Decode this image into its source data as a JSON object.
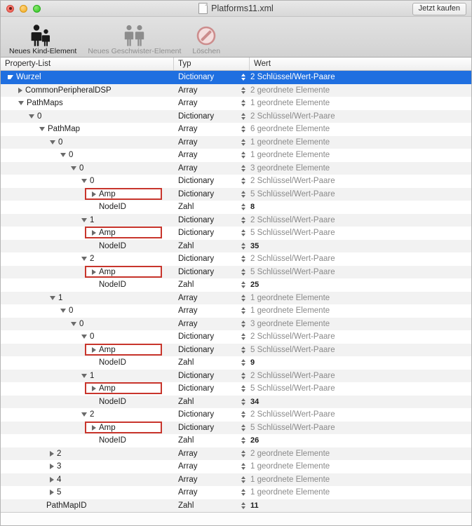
{
  "window": {
    "title": "Platforms11.xml",
    "buy_button": "Jetzt kaufen",
    "traffic_lights": [
      "close-light",
      "minimize-light",
      "zoom-light"
    ],
    "doc_icon": "document-icon"
  },
  "toolbar": {
    "items": [
      {
        "label": "Neues Kind-Element",
        "icon": "two-people-icon",
        "enabled": true
      },
      {
        "label": "Neues Geschwister-Element",
        "icon": "two-people-icon",
        "enabled": false
      },
      {
        "label": "Löschen",
        "icon": "no-entry-icon",
        "enabled": false
      }
    ]
  },
  "columns": {
    "name": "Property-List",
    "type": "Typ",
    "value": "Wert"
  },
  "rows": [
    {
      "level": 0,
      "name": "Wurzel",
      "tri": "open",
      "type": "Dictionary",
      "value": "2 Schlüssel/Wert-Paare",
      "kind": "muted",
      "selected": true,
      "boxed": false
    },
    {
      "level": 1,
      "name": "CommonPeripheralDSP",
      "tri": "closed",
      "type": "Array",
      "value": "2 geordnete Elemente",
      "kind": "muted",
      "selected": false,
      "boxed": false
    },
    {
      "level": 1,
      "name": "PathMaps",
      "tri": "open",
      "type": "Array",
      "value": "1 geordnete Elemente",
      "kind": "muted",
      "selected": false,
      "boxed": false
    },
    {
      "level": 2,
      "name": "0",
      "tri": "open",
      "type": "Dictionary",
      "value": "2 Schlüssel/Wert-Paare",
      "kind": "muted",
      "selected": false,
      "boxed": false
    },
    {
      "level": 3,
      "name": "PathMap",
      "tri": "open",
      "type": "Array",
      "value": "6 geordnete Elemente",
      "kind": "muted",
      "selected": false,
      "boxed": false
    },
    {
      "level": 4,
      "name": "0",
      "tri": "open",
      "type": "Array",
      "value": "1 geordnete Elemente",
      "kind": "muted",
      "selected": false,
      "boxed": false
    },
    {
      "level": 5,
      "name": "0",
      "tri": "open",
      "type": "Array",
      "value": "1 geordnete Elemente",
      "kind": "muted",
      "selected": false,
      "boxed": false
    },
    {
      "level": 6,
      "name": "0",
      "tri": "open",
      "type": "Array",
      "value": "3 geordnete Elemente",
      "kind": "muted",
      "selected": false,
      "boxed": false
    },
    {
      "level": 7,
      "name": "0",
      "tri": "open",
      "type": "Dictionary",
      "value": "2 Schlüssel/Wert-Paare",
      "kind": "muted",
      "selected": false,
      "boxed": false
    },
    {
      "level": 8,
      "name": "Amp",
      "tri": "closed",
      "type": "Dictionary",
      "value": "5 Schlüssel/Wert-Paare",
      "kind": "muted",
      "selected": false,
      "boxed": true
    },
    {
      "level": 8,
      "name": "NodeID",
      "tri": "none",
      "type": "Zahl",
      "value": "8",
      "kind": "num",
      "selected": false,
      "boxed": false
    },
    {
      "level": 7,
      "name": "1",
      "tri": "open",
      "type": "Dictionary",
      "value": "2 Schlüssel/Wert-Paare",
      "kind": "muted",
      "selected": false,
      "boxed": false
    },
    {
      "level": 8,
      "name": "Amp",
      "tri": "closed",
      "type": "Dictionary",
      "value": "5 Schlüssel/Wert-Paare",
      "kind": "muted",
      "selected": false,
      "boxed": true
    },
    {
      "level": 8,
      "name": "NodeID",
      "tri": "none",
      "type": "Zahl",
      "value": "35",
      "kind": "num",
      "selected": false,
      "boxed": false
    },
    {
      "level": 7,
      "name": "2",
      "tri": "open",
      "type": "Dictionary",
      "value": "2 Schlüssel/Wert-Paare",
      "kind": "muted",
      "selected": false,
      "boxed": false
    },
    {
      "level": 8,
      "name": "Amp",
      "tri": "closed",
      "type": "Dictionary",
      "value": "5 Schlüssel/Wert-Paare",
      "kind": "muted",
      "selected": false,
      "boxed": true
    },
    {
      "level": 8,
      "name": "NodeID",
      "tri": "none",
      "type": "Zahl",
      "value": "25",
      "kind": "num",
      "selected": false,
      "boxed": false
    },
    {
      "level": 4,
      "name": "1",
      "tri": "open",
      "type": "Array",
      "value": "1 geordnete Elemente",
      "kind": "muted",
      "selected": false,
      "boxed": false
    },
    {
      "level": 5,
      "name": "0",
      "tri": "open",
      "type": "Array",
      "value": "1 geordnete Elemente",
      "kind": "muted",
      "selected": false,
      "boxed": false
    },
    {
      "level": 6,
      "name": "0",
      "tri": "open",
      "type": "Array",
      "value": "3 geordnete Elemente",
      "kind": "muted",
      "selected": false,
      "boxed": false
    },
    {
      "level": 7,
      "name": "0",
      "tri": "open",
      "type": "Dictionary",
      "value": "2 Schlüssel/Wert-Paare",
      "kind": "muted",
      "selected": false,
      "boxed": false
    },
    {
      "level": 8,
      "name": "Amp",
      "tri": "closed",
      "type": "Dictionary",
      "value": "5 Schlüssel/Wert-Paare",
      "kind": "muted",
      "selected": false,
      "boxed": true
    },
    {
      "level": 8,
      "name": "NodeID",
      "tri": "none",
      "type": "Zahl",
      "value": "9",
      "kind": "num",
      "selected": false,
      "boxed": false
    },
    {
      "level": 7,
      "name": "1",
      "tri": "open",
      "type": "Dictionary",
      "value": "2 Schlüssel/Wert-Paare",
      "kind": "muted",
      "selected": false,
      "boxed": false
    },
    {
      "level": 8,
      "name": "Amp",
      "tri": "closed",
      "type": "Dictionary",
      "value": "5 Schlüssel/Wert-Paare",
      "kind": "muted",
      "selected": false,
      "boxed": true
    },
    {
      "level": 8,
      "name": "NodeID",
      "tri": "none",
      "type": "Zahl",
      "value": "34",
      "kind": "num",
      "selected": false,
      "boxed": false
    },
    {
      "level": 7,
      "name": "2",
      "tri": "open",
      "type": "Dictionary",
      "value": "2 Schlüssel/Wert-Paare",
      "kind": "muted",
      "selected": false,
      "boxed": false
    },
    {
      "level": 8,
      "name": "Amp",
      "tri": "closed",
      "type": "Dictionary",
      "value": "5 Schlüssel/Wert-Paare",
      "kind": "muted",
      "selected": false,
      "boxed": true
    },
    {
      "level": 8,
      "name": "NodeID",
      "tri": "none",
      "type": "Zahl",
      "value": "26",
      "kind": "num",
      "selected": false,
      "boxed": false
    },
    {
      "level": 4,
      "name": "2",
      "tri": "closed",
      "type": "Array",
      "value": "2 geordnete Elemente",
      "kind": "muted",
      "selected": false,
      "boxed": false
    },
    {
      "level": 4,
      "name": "3",
      "tri": "closed",
      "type": "Array",
      "value": "1 geordnete Elemente",
      "kind": "muted",
      "selected": false,
      "boxed": false
    },
    {
      "level": 4,
      "name": "4",
      "tri": "closed",
      "type": "Array",
      "value": "1 geordnete Elemente",
      "kind": "muted",
      "selected": false,
      "boxed": false
    },
    {
      "level": 4,
      "name": "5",
      "tri": "closed",
      "type": "Array",
      "value": "1 geordnete Elemente",
      "kind": "muted",
      "selected": false,
      "boxed": false
    },
    {
      "level": 3,
      "name": "PathMapID",
      "tri": "none",
      "type": "Zahl",
      "value": "11",
      "kind": "num",
      "selected": false,
      "boxed": false
    }
  ]
}
